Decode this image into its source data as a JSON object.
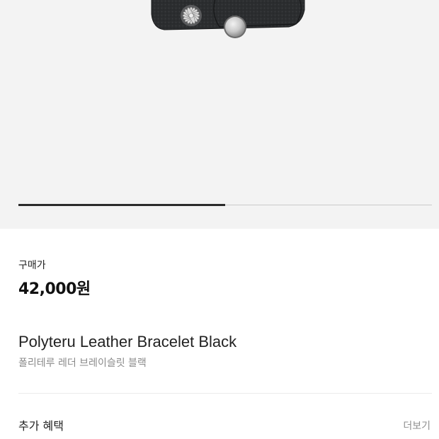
{
  "product_image": {
    "gallery_progress": 0.5
  },
  "price": {
    "label": "구매가",
    "value": "42,000원"
  },
  "product": {
    "name_en": "Polyteru Leather Bracelet Black",
    "name_ko": "폴리테루 레더 브레이슬릿 블랙"
  },
  "benefits": {
    "title": "추가 혜택",
    "more_label": "더보기"
  }
}
